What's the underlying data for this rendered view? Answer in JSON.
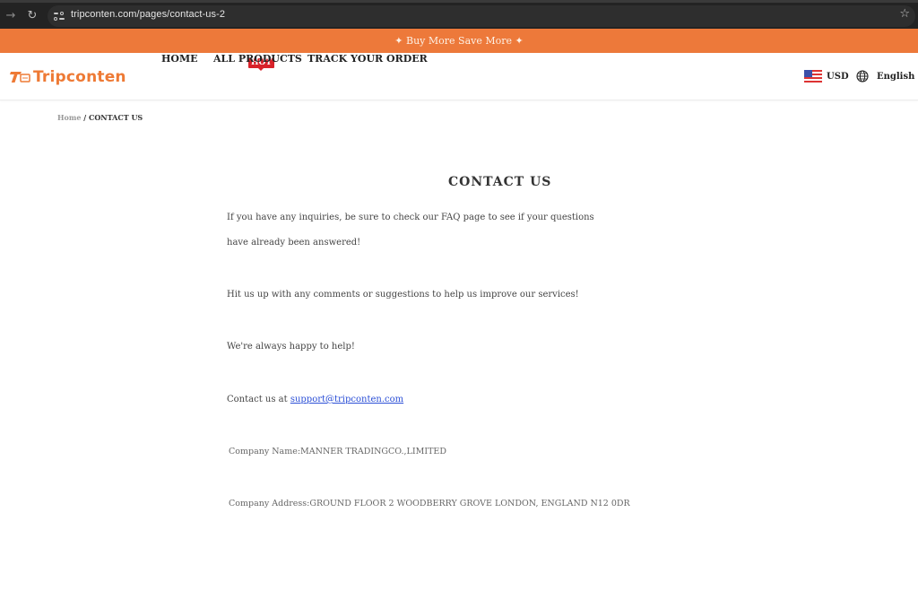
{
  "browser": {
    "url": "tripconten.com/pages/contact-us-2",
    "forward_icon": "arrow-right-icon",
    "reload_icon": "reload-icon",
    "site_info_icon": "tune-icon",
    "bookmark_icon": "star-icon"
  },
  "promo": {
    "text": "Buy More Save More",
    "sparkle": "✦"
  },
  "header": {
    "logo_text": "Tripconten",
    "nav": [
      {
        "label": "HOME"
      },
      {
        "label": "ALL PRODUCTS",
        "badge": "HOT"
      },
      {
        "label": "TRACK YOUR ORDER"
      }
    ],
    "currency": "USD",
    "language": "English"
  },
  "breadcrumb": {
    "home": "Home",
    "separator": "/",
    "current": "CONTACT US"
  },
  "content": {
    "title": "CONTACT US",
    "paragraph1_line1": "If you have any inquiries, be sure to check our FAQ page to see if your questions",
    "paragraph1_line2": "have already been answered!",
    "paragraph2": "Hit us up with any comments or suggestions to help us improve our services!",
    "paragraph3": "We're always happy to help!",
    "contact_prefix": "Contact us at ",
    "email": "support@tripconten.com",
    "company_name": "Company Name:MANNER TRADINGCO.,LIMITED",
    "company_address": "Company Address:GROUND FLOOR 2 WOODBERRY GROVE LONDON, ENGLAND N12 0DR"
  },
  "colors": {
    "brand_orange": "#ed793a",
    "hot_badge": "#d8222a",
    "link_blue": "#2b4fd6"
  }
}
